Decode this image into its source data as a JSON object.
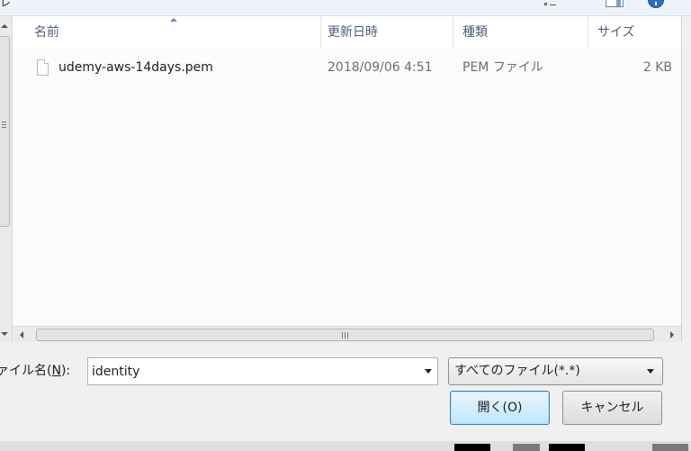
{
  "top_fragment": "レ",
  "columns": [
    {
      "key": "name",
      "label": "名前"
    },
    {
      "key": "date",
      "label": "更新日時"
    },
    {
      "key": "type",
      "label": "種類"
    },
    {
      "key": "size",
      "label": "サイズ"
    }
  ],
  "files": [
    {
      "name": "udemy-aws-14days.pem",
      "date": "2018/09/06 4:51",
      "type": "PEM ファイル",
      "size": "2 KB"
    }
  ],
  "filename": {
    "label_prefix": "ァイル名(",
    "label_accel": "N",
    "label_suffix": "):",
    "value": "identity"
  },
  "filetype": {
    "selected": "すべてのファイル(*.*)"
  },
  "buttons": {
    "open": "開く(O)",
    "cancel": "キャンセル"
  },
  "icons": {
    "view": "view-options-icon",
    "pane": "preview-pane-icon",
    "help": "help-icon",
    "file": "file-icon"
  },
  "colors": {
    "header_text": "#4c607a",
    "open_button": "#bee6fd",
    "help_icon": "#2d6ec4"
  }
}
